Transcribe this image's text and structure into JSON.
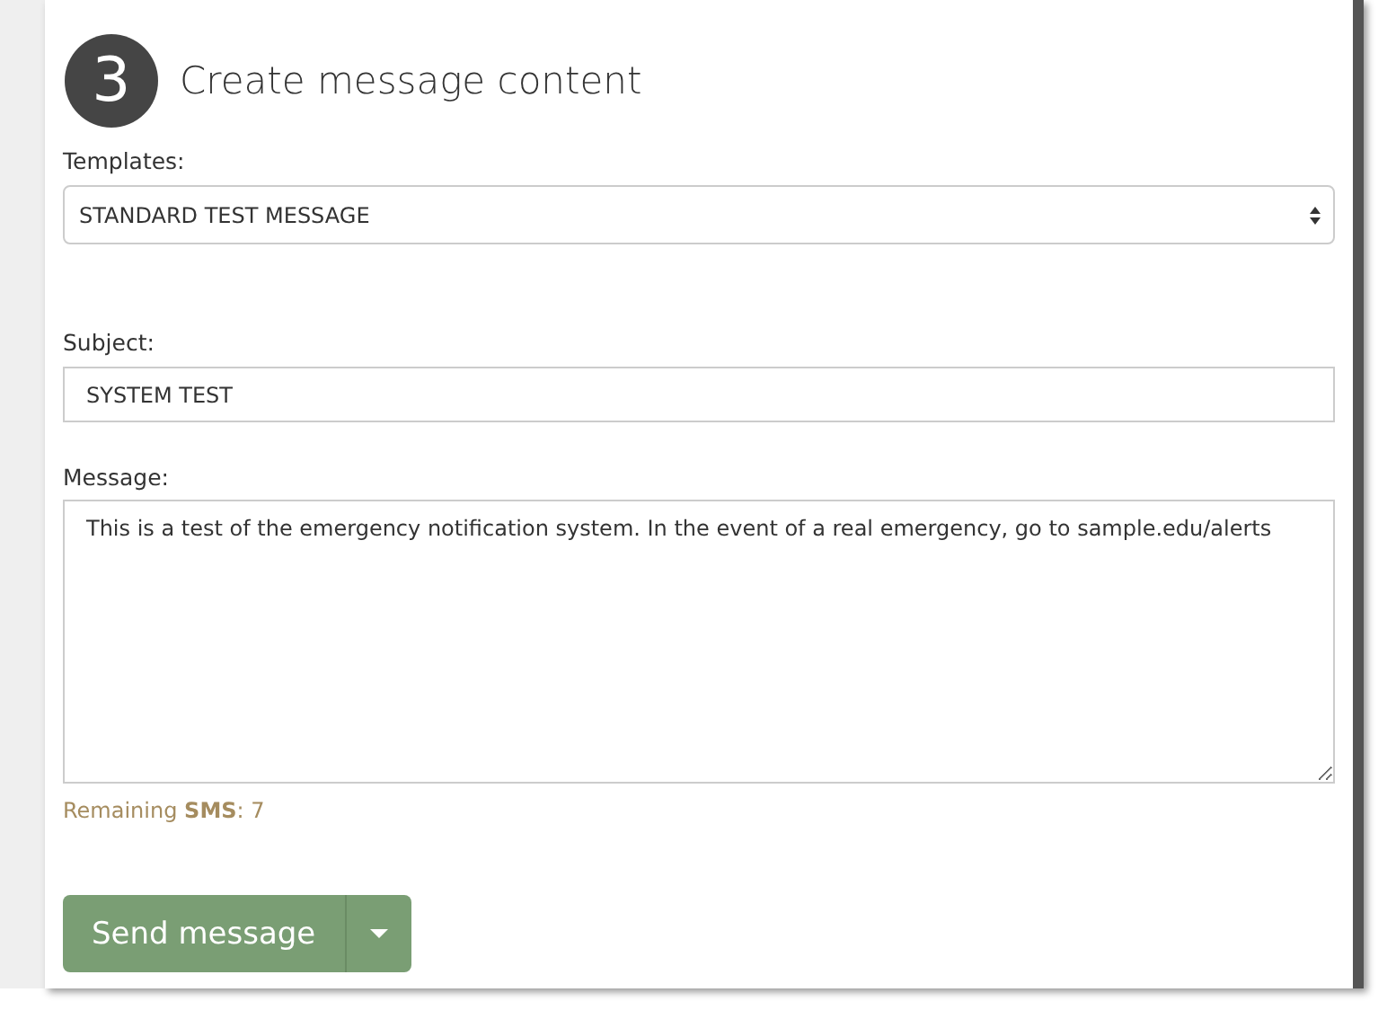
{
  "step": {
    "number": "3",
    "title": "Create message content"
  },
  "templates": {
    "label": "Templates:",
    "value": "STANDARD TEST MESSAGE"
  },
  "subject": {
    "label": "Subject:",
    "value": "SYSTEM TEST"
  },
  "message": {
    "label": "Message:",
    "value": "This is a test of the emergency notification system. In the event of a real emergency, go to sample.edu/alerts"
  },
  "remaining": "Remaining **SMS**: 7",
  "send_button": {
    "label": "Send message"
  }
}
